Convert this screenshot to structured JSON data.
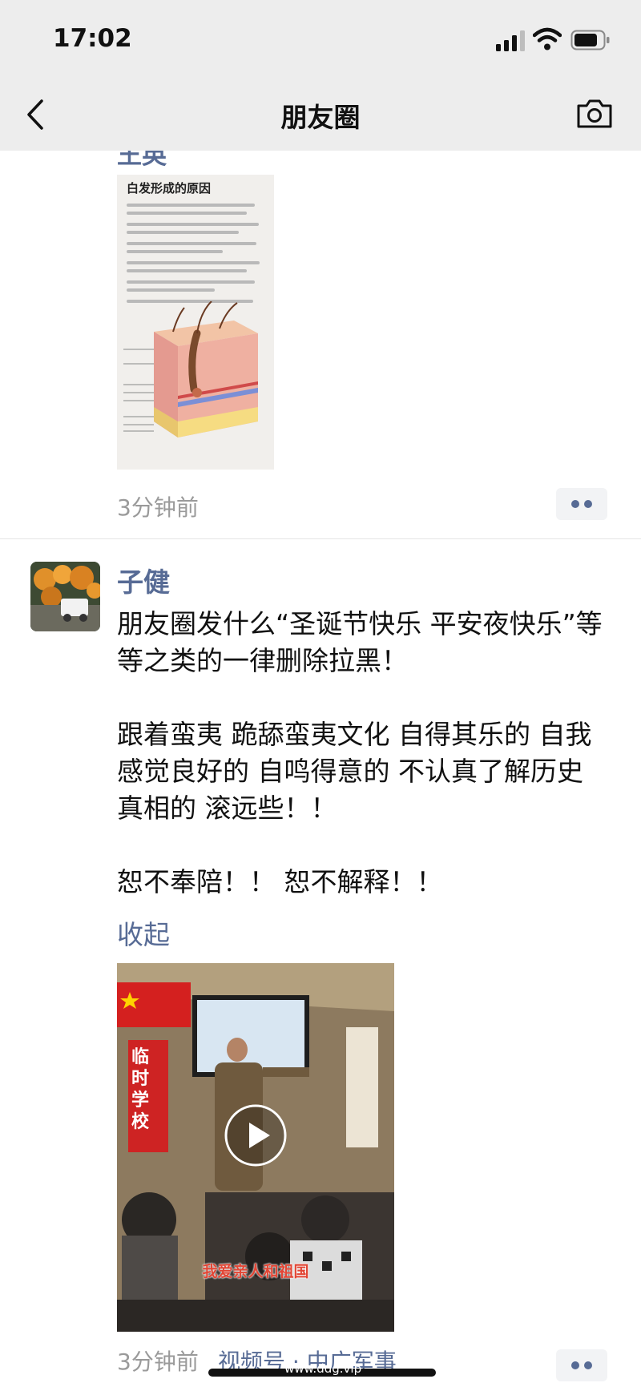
{
  "status_bar": {
    "time": "17:02"
  },
  "nav": {
    "title": "朋友圈"
  },
  "post1": {
    "author_partial": "王英",
    "image_title": "白发形成的原因",
    "time": "3分钟前"
  },
  "post2": {
    "author": "子健",
    "paragraphs": [
      "朋友圈发什么“圣诞节快乐 平安夜快乐”等等之类的一律删除拉黑！",
      "跟着蛮夷 跪舔蛮夷文化 自得其乐的 自我感觉良好的 自鸣得意的 不认真了解历史真相的 滚远些！！",
      "恕不奉陪！！ 恕不解释！！"
    ],
    "collapse_label": "收起",
    "video": {
      "sign_left": "临时学校",
      "caption": "我爱亲人和祖国"
    },
    "time": "3分钟前",
    "channel": "视频号 · 中广军事"
  },
  "watermark": "www.ddg.vip",
  "colors": {
    "link": "#576b95",
    "nav_bg": "#ededed",
    "meta_gray": "#9a9a9a"
  }
}
